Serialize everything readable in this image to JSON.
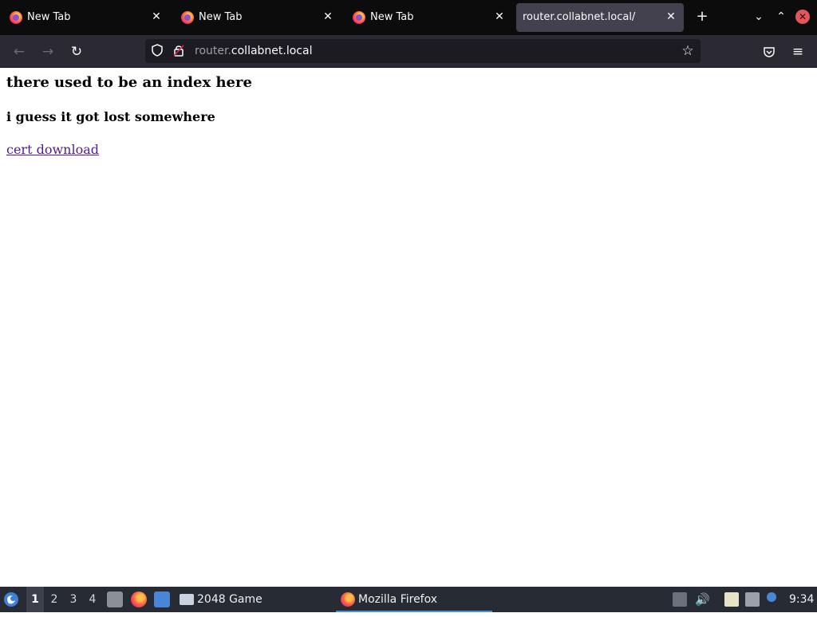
{
  "browser": {
    "tabs": [
      {
        "label": "New Tab",
        "active": false
      },
      {
        "label": "New Tab",
        "active": false
      },
      {
        "label": "New Tab",
        "active": false
      },
      {
        "label": "router.collabnet.local/",
        "active": true
      }
    ],
    "url": {
      "subdomain": "router.",
      "domain": "collabnet.local"
    }
  },
  "page": {
    "heading": "there used to be an index here",
    "subheading": "i guess it got lost somewhere",
    "link_text": "cert download"
  },
  "taskbar": {
    "workspaces": [
      "1",
      "2",
      "3",
      "4"
    ],
    "active_workspace": "1",
    "tasks": [
      {
        "label": "2048 Game",
        "active": false
      },
      {
        "label": "Mozilla Firefox",
        "active": true
      }
    ],
    "clock": "9:34"
  },
  "colors": {
    "link_visited": "#551a8b",
    "tabbar_bg": "#0c0c0d",
    "navbar_bg": "#2b2a33",
    "taskbar_bg": "#272b34"
  },
  "icons": {
    "tab_favicon": "firefox-icon",
    "tab_close": "close-icon",
    "new_tab": "plus-icon",
    "nav": [
      "back-arrow-icon",
      "forward-arrow-icon",
      "reload-icon"
    ],
    "urlbar": [
      "shield-icon",
      "lock-icon",
      "star-icon"
    ],
    "toolbar": [
      "pocket-icon",
      "hamburger-menu-icon"
    ],
    "tray": [
      "volume-icon",
      "clipboard-icon",
      "network-icon",
      "notification-icon"
    ]
  }
}
